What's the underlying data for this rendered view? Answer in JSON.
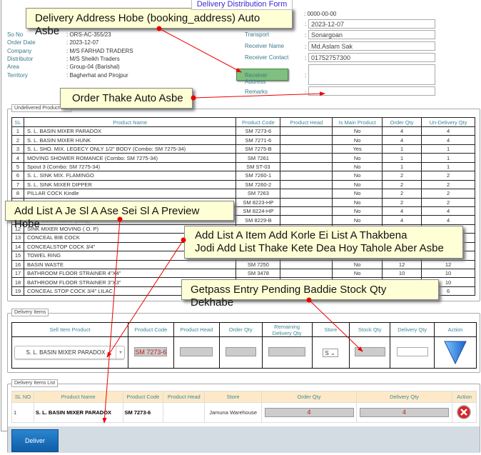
{
  "form_title": "Delivery Distribution Form",
  "order_info": [
    {
      "label": "So No",
      "value": ": ORS-AC-355/23"
    },
    {
      "label": "Order Date",
      "value": ": 2023-12-07"
    },
    {
      "label": "Company",
      "value": ": M/S FARHAD TRADERS"
    },
    {
      "label": "Distributor",
      "value": ": M/S Sheikh Traders"
    },
    {
      "label": "Area",
      "value": ": Group-04 (Barishal)"
    },
    {
      "label": "Territory",
      "value": ": Bagherhat and Pirojpur"
    }
  ],
  "right_info": {
    "top_date": ": 0000-00-00",
    "delivery_date": "2023-12-07",
    "transport_label": "Transport",
    "transport": "Sonargoan",
    "receiver_name_label": "Receiver Name",
    "receiver_name": "Md.Aslam Sak",
    "receiver_contact_label": "Receiver Contact",
    "receiver_contact": "01752757300",
    "receiver_address_label": "Receiver Address",
    "receiver_address": "",
    "remarks_label": "Remarks",
    "remarks": "",
    "colon": ":"
  },
  "undelivered": {
    "legend": "Undelivered Product List",
    "headers": [
      "SL",
      "Product Name",
      "Product Code",
      "Product Head",
      "Is Main Product",
      "Order Qty",
      "Un-Delivery Qty"
    ],
    "rows": [
      [
        "1",
        "S. L. BASIN MIXER PARADOX",
        "SM 7273-6",
        "",
        "No",
        "4",
        "4"
      ],
      [
        "2",
        "S. L. BASIN MIXER HUNK",
        "SM 7271-6",
        "",
        "No",
        "4",
        "4"
      ],
      [
        "3",
        "S. L. SHO. MIX. LEGECY ONLY 1/2\" BODY (Combo: SM 7275-34)",
        "SM 7275-B",
        "",
        "Yes",
        "1",
        "1"
      ],
      [
        "4",
        "MOVING SHOWER ROMANCE (Combo: SM 7275-34)",
        "SM 7261",
        "",
        "No",
        "1",
        "1"
      ],
      [
        "5",
        "Spout 3 (Combo: SM 7275-34)",
        "SM ST-03",
        "",
        "No",
        "1",
        "1"
      ],
      [
        "6",
        "S. L. SINK MIX. FLAMINGO",
        "SM 7260-1",
        "",
        "No",
        "2",
        "2"
      ],
      [
        "7",
        "S. L. SINK MIXER DIPPER",
        "SM 7260-2",
        "",
        "No",
        "2",
        "2"
      ],
      [
        "8",
        "PILLAR COCK Kindle",
        "SM 7263",
        "",
        "No",
        "2",
        "2"
      ],
      [
        "9",
        "",
        "SM 8223-HP",
        "",
        "No",
        "2",
        "2"
      ],
      [
        "10",
        "",
        "SM 8224-HP",
        "",
        "No",
        "4",
        "4"
      ],
      [
        "11",
        "SINK COCK LILAC (Body)",
        "SM 8229-B",
        "",
        "No",
        "4",
        "4"
      ],
      [
        "12",
        "SINK MIXER MOVING ( O. P)",
        "",
        "",
        "",
        "",
        "2"
      ],
      [
        "13",
        "CONCEAL BIB COCK",
        "",
        "",
        "",
        "",
        ""
      ],
      [
        "14",
        "CONCEALSTOP COCK 3/4\"",
        "",
        "",
        "",
        "",
        "2"
      ],
      [
        "15",
        "TOWEL RING",
        "",
        "",
        "",
        "",
        ""
      ],
      [
        "16",
        "BASIN WASTE",
        "SM 7250",
        "",
        "No",
        "12",
        "12"
      ],
      [
        "17",
        "BATHROOM FLOOR STRAINER 4\"X4\"",
        "SM 3478",
        "",
        "No",
        "10",
        "10"
      ],
      [
        "18",
        "BATHROOM FLOOR STRAINER 3\"X3\"",
        "",
        "",
        "",
        "",
        "10"
      ],
      [
        "19",
        "CONCEAL STOP COCK 3/4\" LILAC",
        "",
        "",
        "",
        "",
        "6"
      ]
    ]
  },
  "delivery_items": {
    "legend": "Delivery Items",
    "headers": [
      "Sell Item Product",
      "Product Code",
      "Product Head",
      "Order Qty",
      "Remaining Delivery Qty",
      "Store",
      "Stock Qty",
      "Delivery Qty",
      "Action"
    ],
    "selected_product": "S. L. BASIN MIXER PARADOX",
    "product_code": "SM 7273-6",
    "store": "S",
    "add_icon": "blue-down-triangle"
  },
  "delivery_list": {
    "legend": "Delivery Items List",
    "headers": [
      "SL NO",
      "Product Name",
      "Product Code",
      "Product Head",
      "Store",
      "Order Qty",
      "Delivery Qty",
      "Action"
    ],
    "rows": [
      {
        "sl": "1",
        "name": "S. L. BASIN MIXER PARADOX",
        "code": "SM 7273-6",
        "head": "",
        "store": "Jamuna Warehouse",
        "order_qty": "4",
        "delivery_qty": "4"
      }
    ]
  },
  "deliver_label": "Deliver",
  "annotations": [
    "Delivery Address Hobe (booking_address) Auto Asbe",
    "Order Thake Auto Asbe",
    "Add List A Je Sl A Ase Sei Sl A Preview Hobe",
    "Add List A Item Add Korle Ei List A Thakbena",
    "Jodi Add List Thake Kete Dea Hoy Tahole Aber Asbe",
    "Getpass Entry Pending Baddie Stock Qty Dekhabe"
  ],
  "colors": {
    "accent": "#3b8a9a",
    "callout": "#ffffd6",
    "arrow": "#e00000",
    "deliver": "#1a6fb5"
  }
}
